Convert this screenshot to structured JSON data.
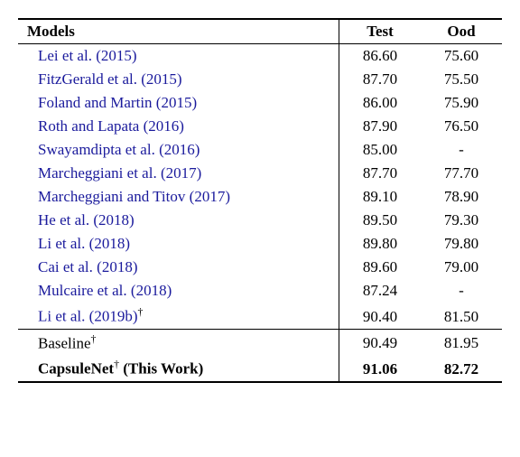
{
  "headers": {
    "models": "Models",
    "test": "Test",
    "ood": "Ood"
  },
  "rows": [
    {
      "label": "Lei et al.",
      "year": "2015",
      "test": "86.60",
      "ood": "75.60"
    },
    {
      "label": "FitzGerald et al.",
      "year": "2015",
      "test": "87.70",
      "ood": "75.50"
    },
    {
      "label": "Foland and Martin",
      "year": "2015",
      "test": "86.00",
      "ood": "75.90"
    },
    {
      "label": "Roth and Lapata",
      "year": "2016",
      "test": "87.90",
      "ood": "76.50"
    },
    {
      "label": "Swayamdipta et al.",
      "year": "2016",
      "test": "85.00",
      "ood": "-"
    },
    {
      "label": "Marcheggiani et al.",
      "year": "2017",
      "test": "87.70",
      "ood": "77.70"
    },
    {
      "label": "Marcheggiani and Titov",
      "year": "2017",
      "test": "89.10",
      "ood": "78.90"
    },
    {
      "label": "He et al.",
      "year": "2018",
      "test": "89.50",
      "ood": "79.30"
    },
    {
      "label": "Li et al.",
      "year": "2018",
      "test": "89.80",
      "ood": "79.80"
    },
    {
      "label": "Cai et al.",
      "year": "2018",
      "test": "89.60",
      "ood": "79.00"
    },
    {
      "label": "Mulcaire et al.",
      "year": "2018",
      "test": "87.24",
      "ood": "-"
    },
    {
      "label": "Li et al.",
      "year": "2019b",
      "test": "90.40",
      "ood": "81.50"
    }
  ],
  "baseline": {
    "label": "Baseline",
    "test": "90.49",
    "ood": "81.95"
  },
  "thiswork": {
    "label": "CapsuleNet",
    "suffix": "(This Work)",
    "test": "91.06",
    "ood": "82.72"
  },
  "dagger": "†",
  "chart_data": {
    "type": "table",
    "columns": [
      "Model",
      "Test",
      "Ood"
    ],
    "rows": [
      [
        "Lei et al. (2015)",
        86.6,
        75.6
      ],
      [
        "FitzGerald et al. (2015)",
        87.7,
        75.5
      ],
      [
        "Foland and Martin (2015)",
        86.0,
        75.9
      ],
      [
        "Roth and Lapata (2016)",
        87.9,
        76.5
      ],
      [
        "Swayamdipta et al. (2016)",
        85.0,
        null
      ],
      [
        "Marcheggiani et al. (2017)",
        87.7,
        77.7
      ],
      [
        "Marcheggiani and Titov (2017)",
        89.1,
        78.9
      ],
      [
        "He et al. (2018)",
        89.5,
        79.3
      ],
      [
        "Li et al. (2018)",
        89.8,
        79.8
      ],
      [
        "Cai et al. (2018)",
        89.6,
        79.0
      ],
      [
        "Mulcaire et al. (2018)",
        87.24,
        null
      ],
      [
        "Li et al. (2019b)†",
        90.4,
        81.5
      ],
      [
        "Baseline†",
        90.49,
        81.95
      ],
      [
        "CapsuleNet† (This Work)",
        91.06,
        82.72
      ]
    ]
  }
}
